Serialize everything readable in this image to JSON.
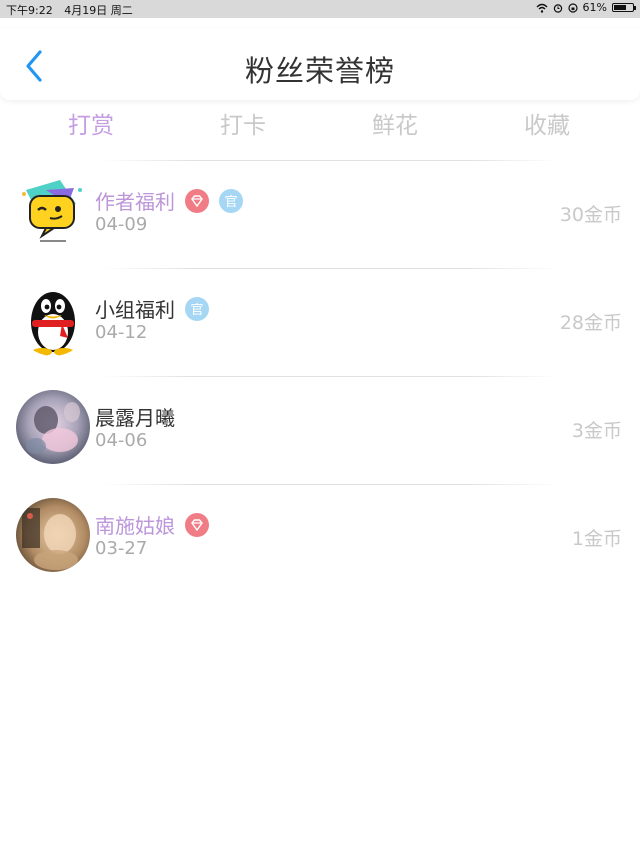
{
  "status_bar": {
    "time": "下午9:22",
    "date": "4月19日 周二",
    "battery": "61%",
    "battery_level": 0.61
  },
  "header": {
    "title": "粉丝荣誉榜",
    "back_icon": "chevron-left-icon"
  },
  "tabs": [
    {
      "label": "打赏",
      "active": true
    },
    {
      "label": "打卡",
      "active": false
    },
    {
      "label": "鲜花",
      "active": false
    },
    {
      "label": "收藏",
      "active": false
    }
  ],
  "fans": [
    {
      "name": "作者福利",
      "date": "04-09",
      "coins": "30金币",
      "avatar": "emoji-wink-avatar",
      "diamond_badge": true,
      "official_badge": true
    },
    {
      "name": "小组福利",
      "date": "04-12",
      "coins": "28金币",
      "avatar": "penguin-avatar",
      "diamond_badge": false,
      "official_badge": true
    },
    {
      "name": "晨露月曦",
      "date": "04-06",
      "coins": "3金币",
      "avatar": "photo-avatar",
      "diamond_badge": false,
      "official_badge": false
    },
    {
      "name": "南施姑娘",
      "date": "03-27",
      "coins": "1金币",
      "avatar": "photo-avatar",
      "diamond_badge": true,
      "official_badge": false
    }
  ],
  "badges": {
    "official_label": "官"
  },
  "colors": {
    "accent": "#c59ee2",
    "vip_name": "#bc96d9",
    "back_arrow": "#2196f3",
    "diamond_badge": "#f07d86",
    "official_badge": "#a5d7f5",
    "inactive_tab": "#c9c9c9"
  }
}
